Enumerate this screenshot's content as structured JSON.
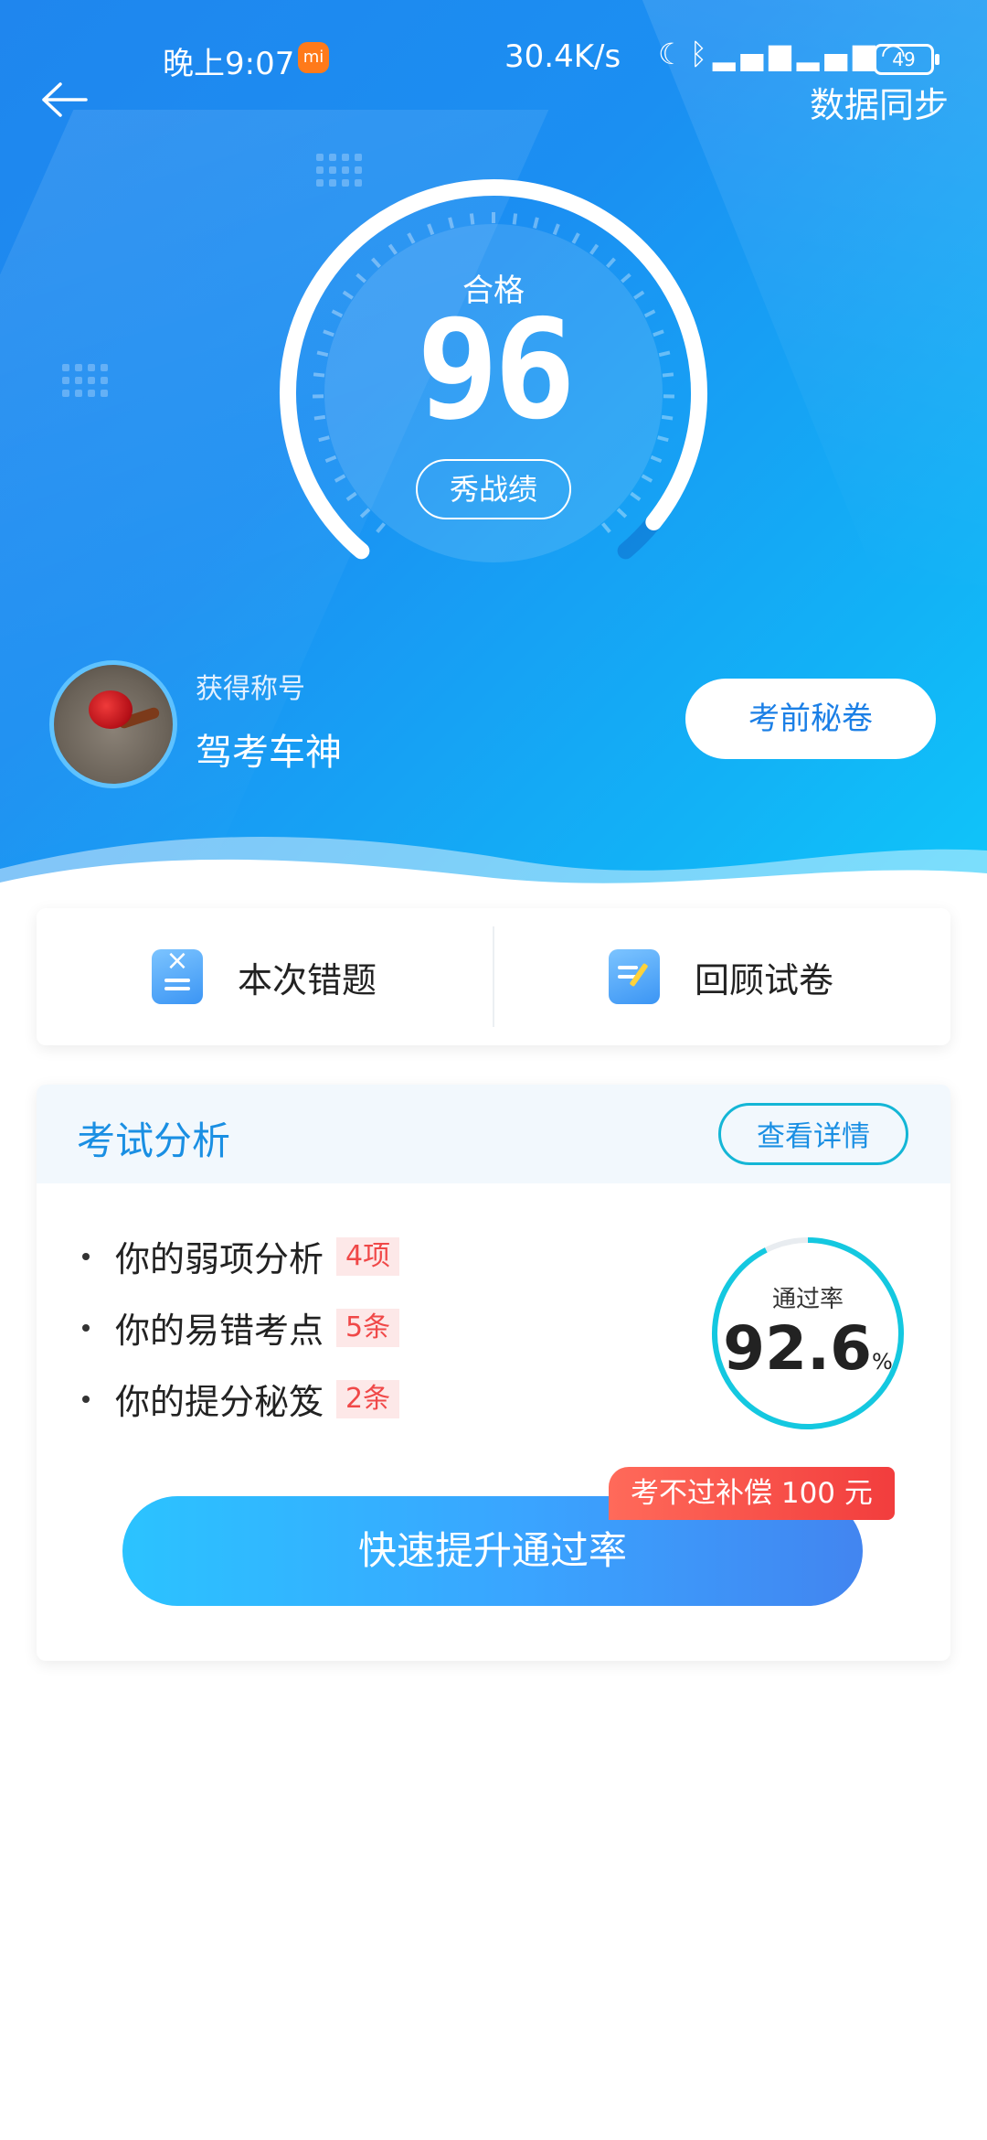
{
  "status_bar": {
    "time": "晚上9:07",
    "net_speed": "30.4K/s",
    "battery": "49"
  },
  "header": {
    "sync_label": "数据同步"
  },
  "result": {
    "status": "合格",
    "score": "96",
    "show_label": "秀战绩"
  },
  "profile": {
    "title_label": "获得称号",
    "title_value": "驾考车神",
    "secret_button": "考前秘卷"
  },
  "actions": {
    "wrong_questions": "本次错题",
    "review_paper": "回顾试卷"
  },
  "analysis": {
    "title": "考试分析",
    "detail_button": "查看详情",
    "items": [
      {
        "label": "你的弱项分析",
        "tag": "4项"
      },
      {
        "label": "你的易错考点",
        "tag": "5条"
      },
      {
        "label": "你的提分秘笈",
        "tag": "2条"
      }
    ],
    "pass_rate_label": "通过率",
    "pass_rate_value": "92.6",
    "pass_rate_unit": "%",
    "pass_rate_fraction": 0.926,
    "boost_button": "快速提升通过率",
    "promo_badge": "考不过补偿 100 元"
  },
  "score_fraction": 0.96,
  "colors": {
    "primary": "#1b8ff2",
    "accent_cyan": "#14c8e0",
    "warning_red": "#f04848"
  }
}
